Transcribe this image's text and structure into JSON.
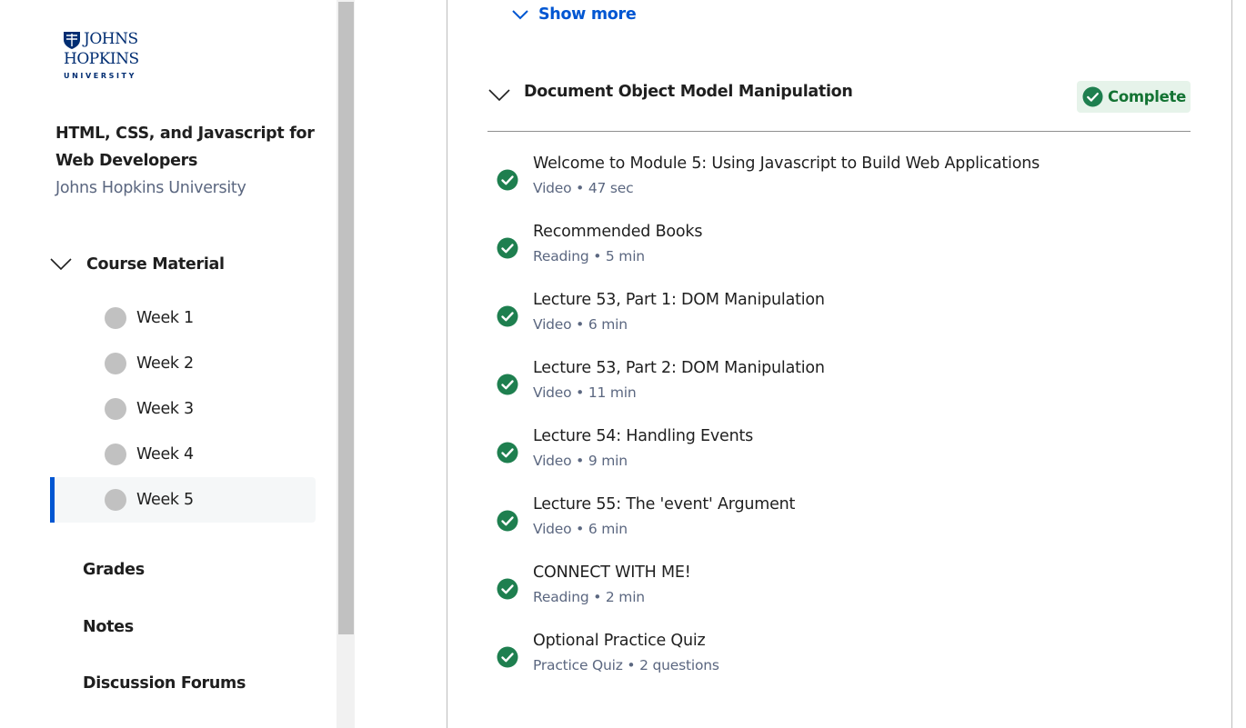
{
  "logo": {
    "line1": "JOHNS",
    "line2": "HOPKINS",
    "line3": "UNIVERSITY"
  },
  "course": {
    "title": "HTML, CSS, and Javascript for Web Developers",
    "institution": "Johns Hopkins University"
  },
  "sidebar": {
    "section_label": "Course Material",
    "weeks": [
      {
        "label": "Week 1",
        "active": false
      },
      {
        "label": "Week 2",
        "active": false
      },
      {
        "label": "Week 3",
        "active": false
      },
      {
        "label": "Week 4",
        "active": false
      },
      {
        "label": "Week 5",
        "active": true
      }
    ],
    "links": [
      "Grades",
      "Notes",
      "Discussion Forums"
    ]
  },
  "main": {
    "show_more": "Show more",
    "module": {
      "title": "Document Object Model Manipulation",
      "status": "Complete",
      "items": [
        {
          "title": "Welcome to Module 5: Using Javascript to Build Web Applications",
          "meta": "Video • 47 sec"
        },
        {
          "title": "Recommended Books",
          "meta": "Reading • 5 min"
        },
        {
          "title": "Lecture 53, Part 1: DOM Manipulation",
          "meta": "Video • 6 min"
        },
        {
          "title": "Lecture 53, Part 2: DOM Manipulation",
          "meta": "Video • 11 min"
        },
        {
          "title": "Lecture 54: Handling Events",
          "meta": "Video • 9 min"
        },
        {
          "title": "Lecture 55: The 'event' Argument",
          "meta": "Video • 6 min"
        },
        {
          "title": "CONNECT WITH ME!",
          "meta": "Reading • 2 min"
        },
        {
          "title": "Optional Practice Quiz",
          "meta": "Practice Quiz • 2 questions"
        }
      ]
    }
  },
  "colors": {
    "accent": "#0056d2",
    "complete_green": "#1e7f4f",
    "badge_bg": "#e6f3ea",
    "logo_blue": "#002d72"
  }
}
